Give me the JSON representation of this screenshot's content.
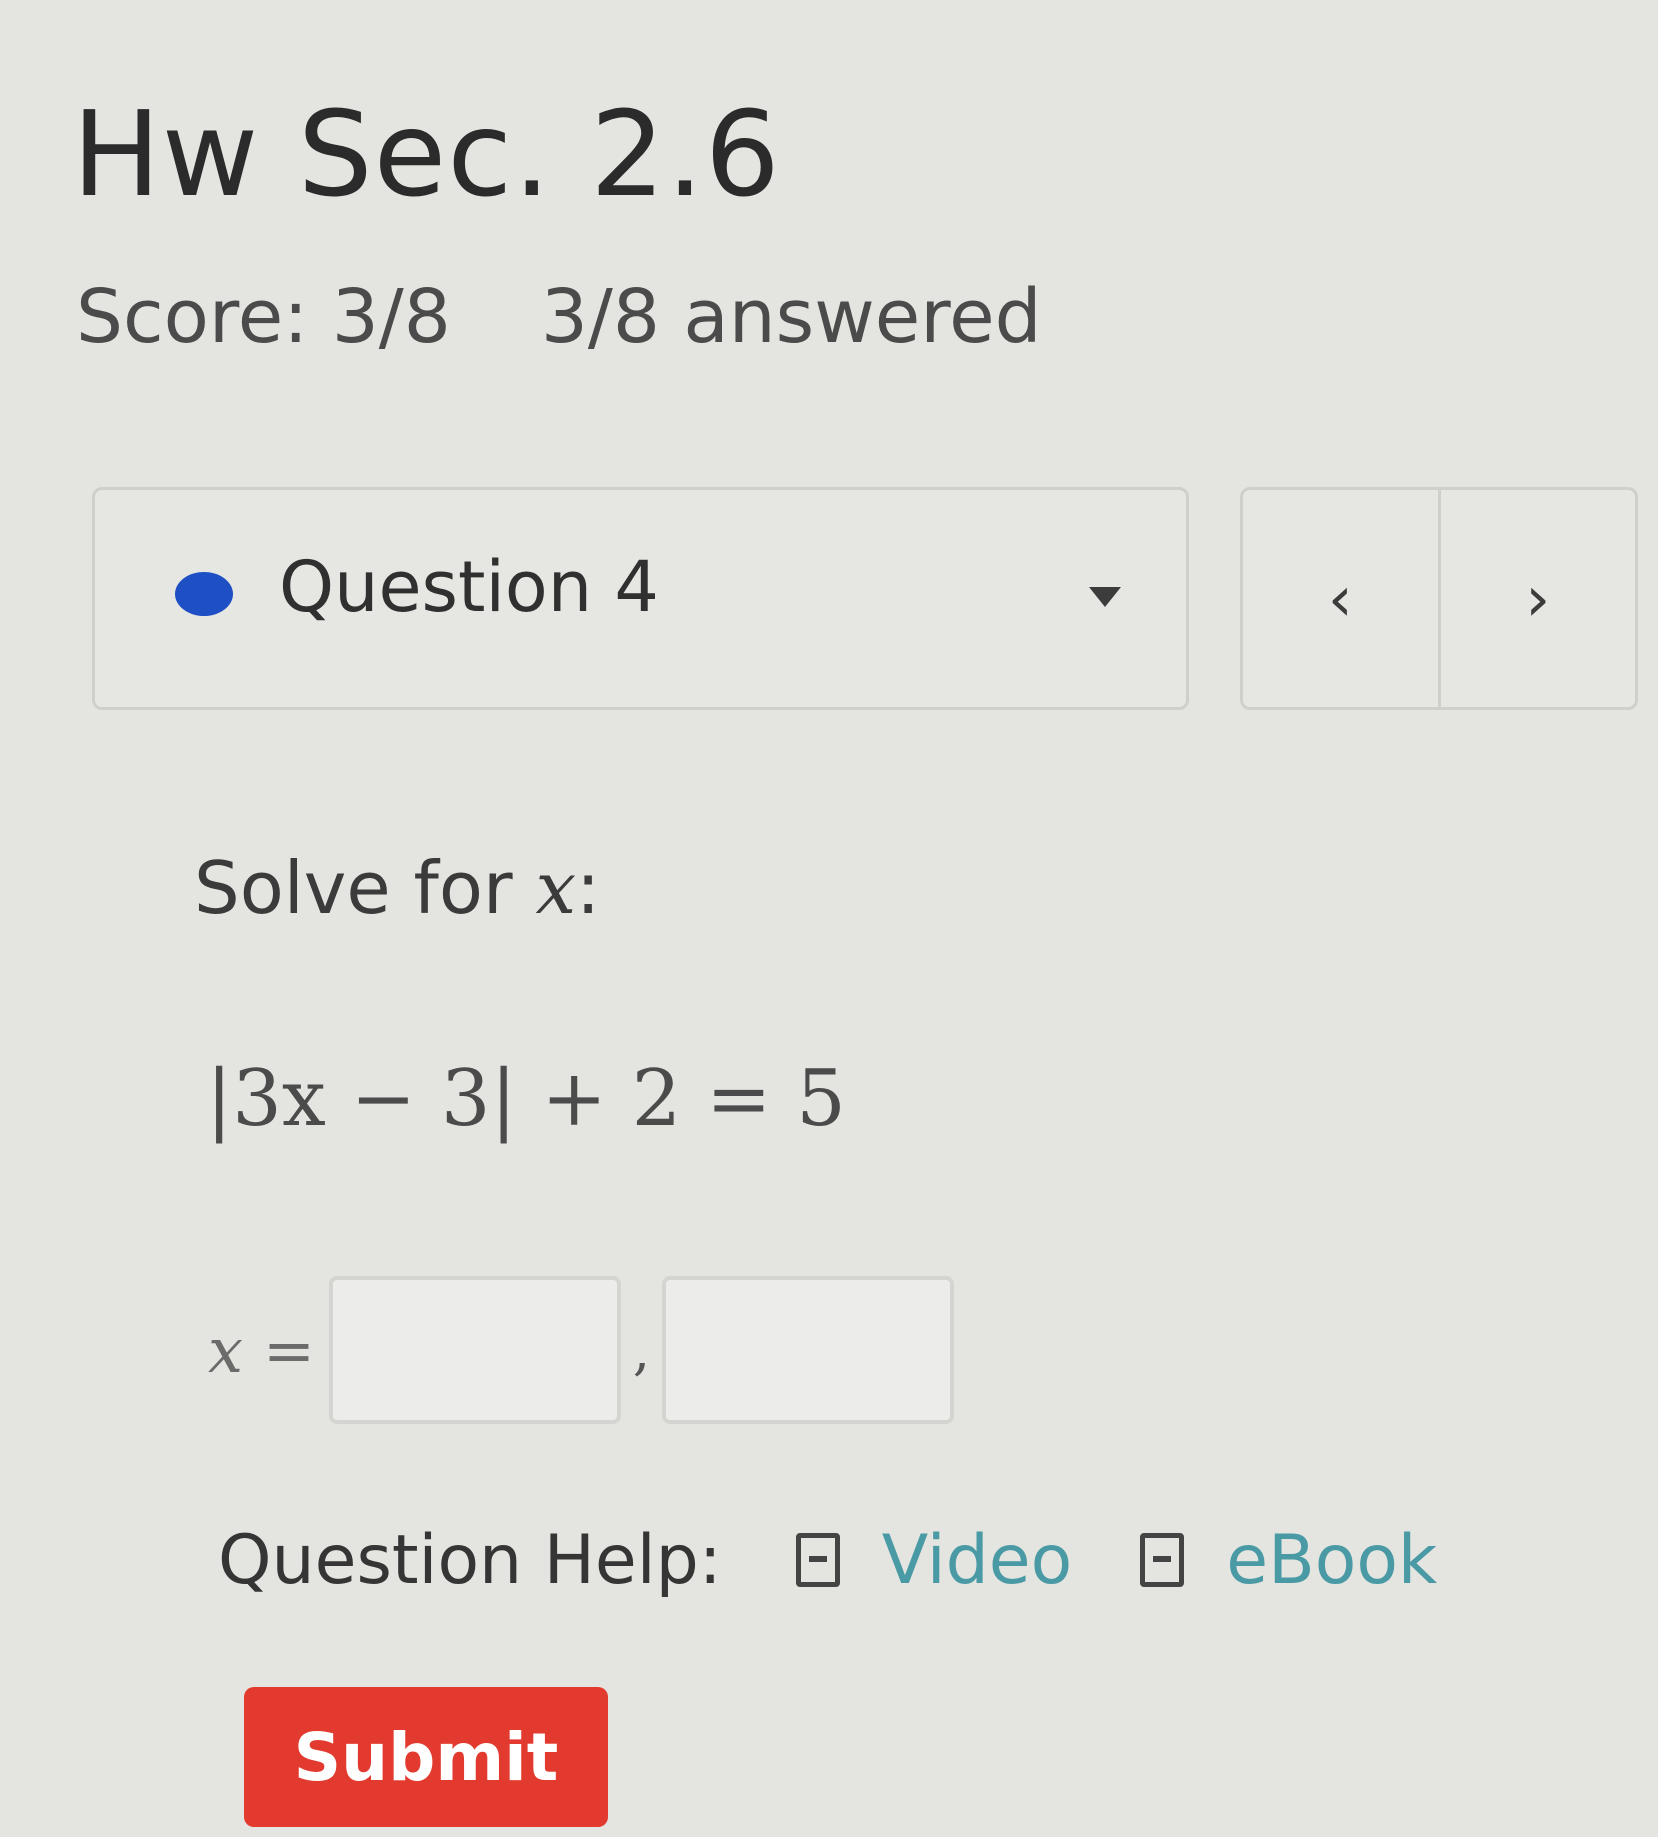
{
  "header": {
    "title": "Hw Sec. 2.6",
    "score": "Score: 3/8",
    "answered": "3/8 answered"
  },
  "question_nav": {
    "current": "Question 4",
    "prev_icon": "‹",
    "next_icon": "›",
    "status_color": "#1f4fc4"
  },
  "question": {
    "prompt_prefix": "Solve for ",
    "prompt_var": "x",
    "prompt_suffix": ":",
    "equation": "|3x − 3| + 2 = 5",
    "answer_var": "x",
    "answer_equals": "=",
    "separator": ",",
    "answer_1": "",
    "answer_2": ""
  },
  "help": {
    "label": "Question Help:",
    "video_label": "Video",
    "ebook_label": "eBook"
  },
  "actions": {
    "submit_label": "Submit",
    "submit_color": "#e23a2e"
  }
}
